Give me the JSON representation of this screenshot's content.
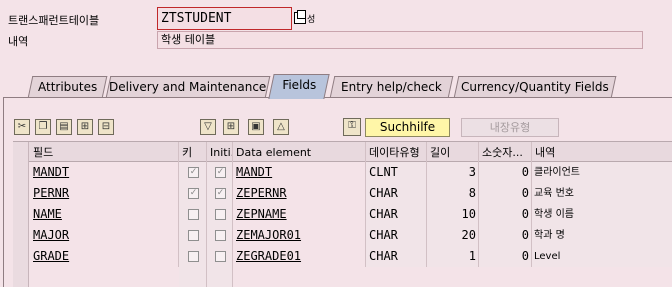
{
  "header": {
    "table_label": "트랜스패런트테이블",
    "table_value": "ZTSTUDENT",
    "status_suffix": "성",
    "desc_label": "내역",
    "desc_value": "학생 테이블"
  },
  "tabs": [
    {
      "label": "Attributes",
      "active": false
    },
    {
      "label": "Delivery and Maintenance",
      "active": false
    },
    {
      "label": "Fields",
      "active": true
    },
    {
      "label": "Entry help/check",
      "active": false
    },
    {
      "label": "Currency/Quantity Fields",
      "active": false
    }
  ],
  "toolbar": {
    "search_help_label": "Suchhilfe",
    "builtin_type_label": "내장유형",
    "icons": [
      "cut-icon",
      "copy-icon",
      "paste-icon",
      "insert-row-icon",
      "delete-row-icon",
      "filter-icon",
      "new-rows-icon",
      "find-icon",
      "sort-up-icon",
      "key-icon"
    ]
  },
  "columns": {
    "field": "필드",
    "key": "키",
    "initial": "Initi...",
    "data_element": "Data element",
    "data_type": "데이타유형",
    "length": "길이",
    "decimals": "소숫자...",
    "description": "내역"
  },
  "rows": [
    {
      "field": "MANDT",
      "key": true,
      "initial": true,
      "data_element": "MANDT",
      "type": "CLNT",
      "length": "3",
      "decimals": "0",
      "description": "클라이언트"
    },
    {
      "field": "PERNR",
      "key": true,
      "initial": true,
      "data_element": "ZEPERNR",
      "type": "CHAR",
      "length": "8",
      "decimals": "0",
      "description": "교육 번호"
    },
    {
      "field": "NAME",
      "key": false,
      "initial": false,
      "data_element": "ZEPNAME",
      "type": "CHAR",
      "length": "10",
      "decimals": "0",
      "description": "학생 이름"
    },
    {
      "field": "MAJOR",
      "key": false,
      "initial": false,
      "data_element": "ZEMAJOR01",
      "type": "CHAR",
      "length": "20",
      "decimals": "0",
      "description": "학과 명"
    },
    {
      "field": "GRADE",
      "key": false,
      "initial": false,
      "data_element": "ZEGRADE01",
      "type": "CHAR",
      "length": "1",
      "decimals": "0",
      "description": "Level"
    }
  ]
}
